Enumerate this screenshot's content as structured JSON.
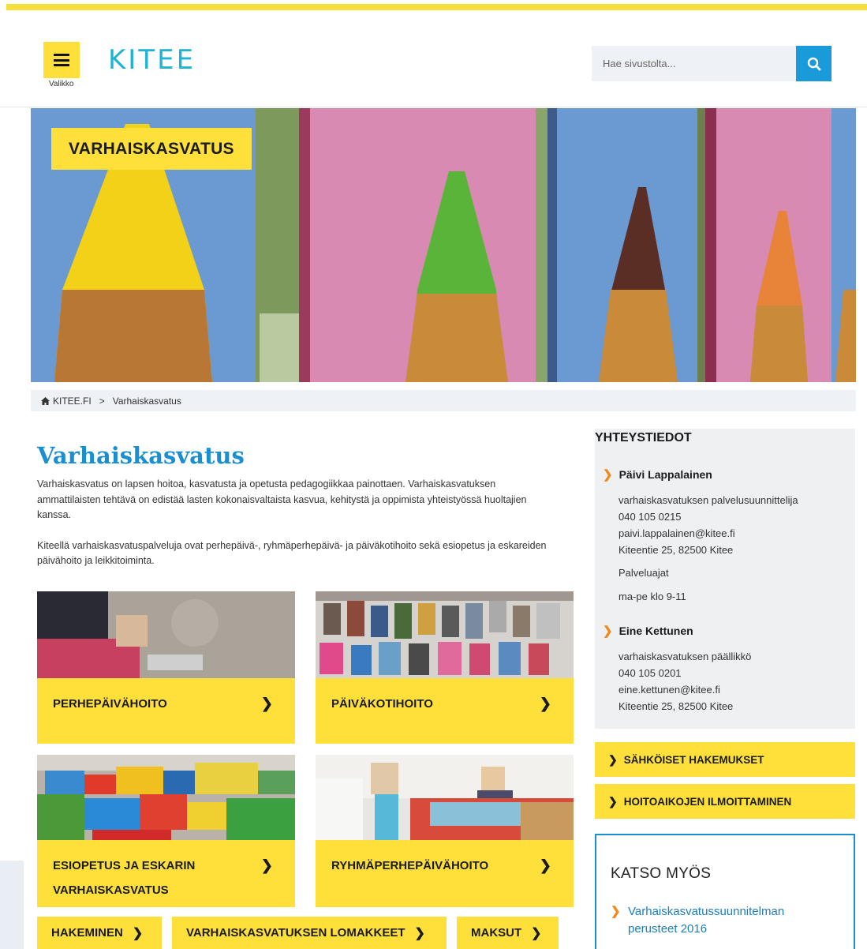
{
  "header": {
    "menu_label": "Valikko",
    "logo_text": "KITEE",
    "search_placeholder": "Hae sivustolta..."
  },
  "hero": {
    "badge": "VARHAISKASVATUS"
  },
  "breadcrumb": {
    "home": "KITEE.FI",
    "separator": ">",
    "current": "Varhaiskasvatus"
  },
  "main": {
    "title": "Varhaiskasvatus",
    "paragraphs": [
      "Varhaiskasvatus on lapsen hoitoa, kasvatusta ja opetusta pedagogiikkaa painottaen. Varhaiskasvatuksen ammattilaisten tehtävä on edistää lasten kokonaisvaltaista kasvua, kehitystä ja oppimista yhteistyössä huoltajien kanssa.",
      "Kiteellä varhaiskasvatuspalveluja ovat perhepäivä-, ryhmäperhepäivä- ja päiväkotihoito sekä esiopetus ja eskareiden päivähoito ja leikkitoiminta."
    ],
    "cards": [
      {
        "label": "PERHEPÄIVÄHOITO",
        "image": "child-chalk-photo"
      },
      {
        "label": "PÄIVÄKOTIHOITO",
        "image": "shoe-rack-photo"
      },
      {
        "label": "ESIOPETUS JA ESKARIN VARHAISKASVATUS",
        "image": "lego-blocks-photo"
      },
      {
        "label": "RYHMÄPERHEPÄIVÄHOITO",
        "image": "children-puzzle-photo"
      }
    ],
    "bottom_buttons": [
      {
        "label": "HAKEMINEN"
      },
      {
        "label": "VARHAISKASVATUKSEN LOMAKKEET"
      },
      {
        "label": "MAKSUT"
      }
    ]
  },
  "sidebar": {
    "contacts_title": "YHTEYSTIEDOT",
    "contacts": [
      {
        "name": "Päivi Lappalainen",
        "title": "varhaiskasvatuksen palvelusuunnittelija",
        "phone": "040 105 0215",
        "email": "paivi.lappalainen@kitee.fi",
        "address": "Kiteentie 25, 82500 Kitee",
        "hours_label": "Palveluajat",
        "hours": "ma-pe klo 9-11"
      },
      {
        "name": "Eine Kettunen",
        "title": "varhaiskasvatuksen päällikkö",
        "phone": "040 105 0201",
        "email": "eine.kettunen@kitee.fi",
        "address": "Kiteentie 25, 82500 Kitee"
      }
    ],
    "buttons": [
      {
        "label": "SÄHKÖISET HAKEMUKSET"
      },
      {
        "label": "HOITOAIKOJEN ILMOITTAMINEN"
      }
    ],
    "see_also": {
      "title": "KATSO MYÖS",
      "links": [
        {
          "label": "Varhaiskasvatussuunnitelman perusteet 2016"
        }
      ]
    }
  },
  "colors": {
    "accent_yellow": "#ffe03a",
    "brand_blue": "#1a8fcf",
    "logo_cyan": "#1fb3d6",
    "search_blue": "#1a9bd9",
    "arrow_orange": "#f08a1d"
  }
}
